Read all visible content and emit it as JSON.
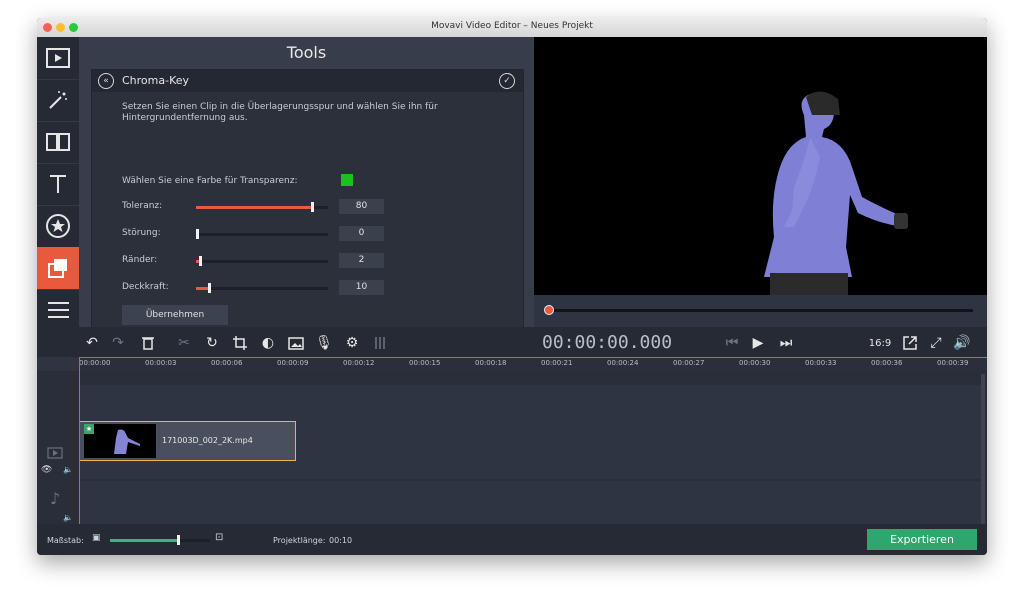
{
  "window": {
    "title": "Movavi Video Editor – Neues Projekt"
  },
  "tools": {
    "title": "Tools",
    "panel_name": "Chroma-Key",
    "description": "Setzen Sie einen Clip in die Überlagerungsspur und wählen Sie ihn für Hintergrundentfernung aus.",
    "color_label": "Wählen Sie eine Farbe für Transparenz:",
    "key_color": "#19c31b",
    "sliders": [
      {
        "label": "Toleranz:",
        "value": "80",
        "fraction": 0.88
      },
      {
        "label": "Störung:",
        "value": "0",
        "fraction": 0.0
      },
      {
        "label": "Ränder:",
        "value": "2",
        "fraction": 0.03
      },
      {
        "label": "Deckkraft:",
        "value": "10",
        "fraction": 0.1
      }
    ],
    "apply_label": "Übernehmen"
  },
  "player": {
    "timecode": "00:00:00.000",
    "aspect_label": "16:9"
  },
  "ruler": {
    "ticks": [
      "00:00:00",
      "00:00:03",
      "00:00:06",
      "00:00:09",
      "00:00:12",
      "00:00:15",
      "00:00:18",
      "00:00:21",
      "00:00:24",
      "00:00:27",
      "00:00:30",
      "00:00:33",
      "00:00:36",
      "00:00:39"
    ]
  },
  "timeline": {
    "clip_name": "171003D_002_2K.mp4"
  },
  "status": {
    "scale_label": "Maßstab:",
    "project_length_label": "Projektlänge:",
    "project_length_value": "00:10",
    "export_label": "Exportieren"
  },
  "colors": {
    "accent": "#e8593d",
    "export": "#2ea66d",
    "clip_border": "#f0b43b"
  }
}
